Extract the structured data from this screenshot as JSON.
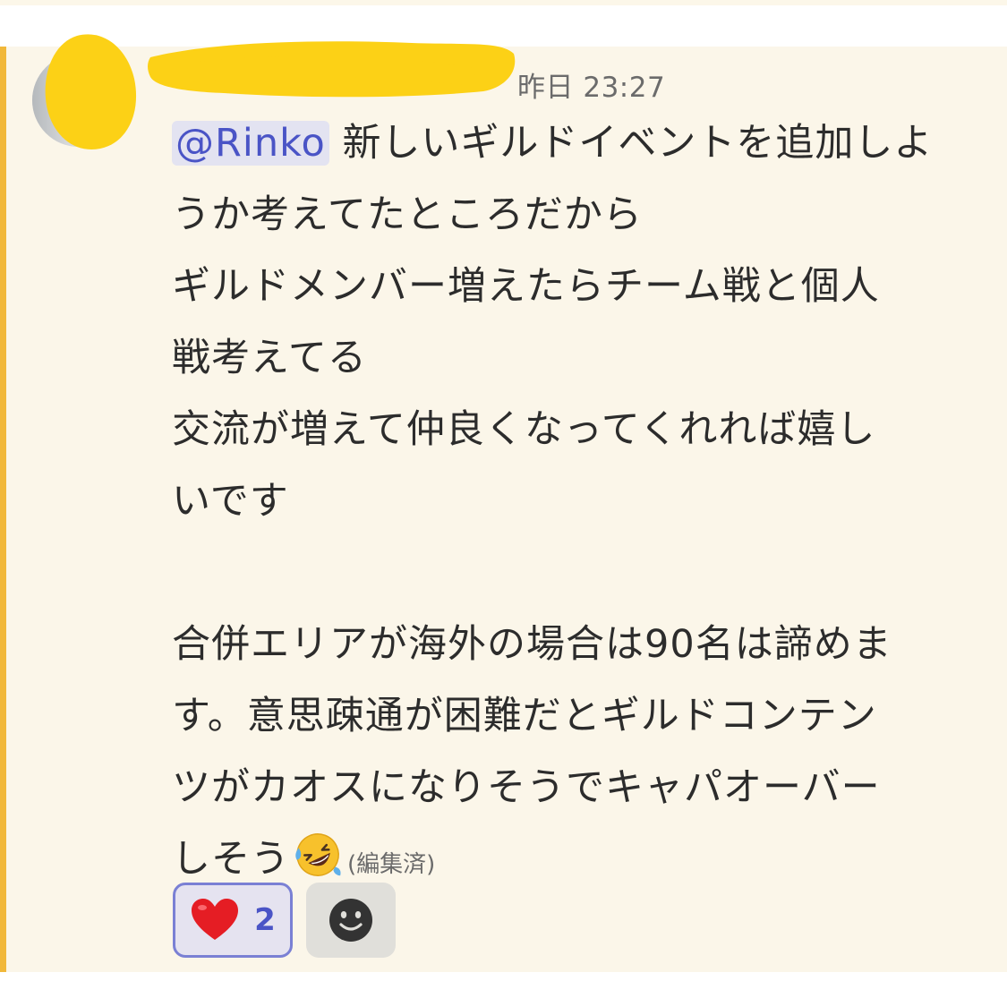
{
  "message": {
    "timestamp": "昨日 23:27",
    "mention": "@Rinko",
    "lines": [
      "新しいギルドイベントを追加しよ",
      "うか考えてたところだから",
      "ギルドメンバー増えたらチーム戦と個人",
      "戦考えてる",
      "交流が増えて仲良くなってくれれば嬉し",
      "いです",
      "",
      "合併エリアが海外の場合は90名は諦めま",
      "す。意思疎通が困難だとギルドコンテン",
      "ツがカオスになりそうでキャパオーバー",
      "しそう"
    ],
    "inline_emoji": "rolling-on-floor-laughing",
    "edited_label": "(編集済)"
  },
  "reactions": {
    "heart": {
      "emoji": "heart",
      "count": "2"
    },
    "add_reaction_icon": "smiley-add-icon"
  },
  "colors": {
    "message_bg": "#fbf6e9",
    "accent": "#f1b83a",
    "mention_text": "#4a54c6",
    "mention_bg": "#e3e3f1",
    "redaction": "#fcd116"
  }
}
